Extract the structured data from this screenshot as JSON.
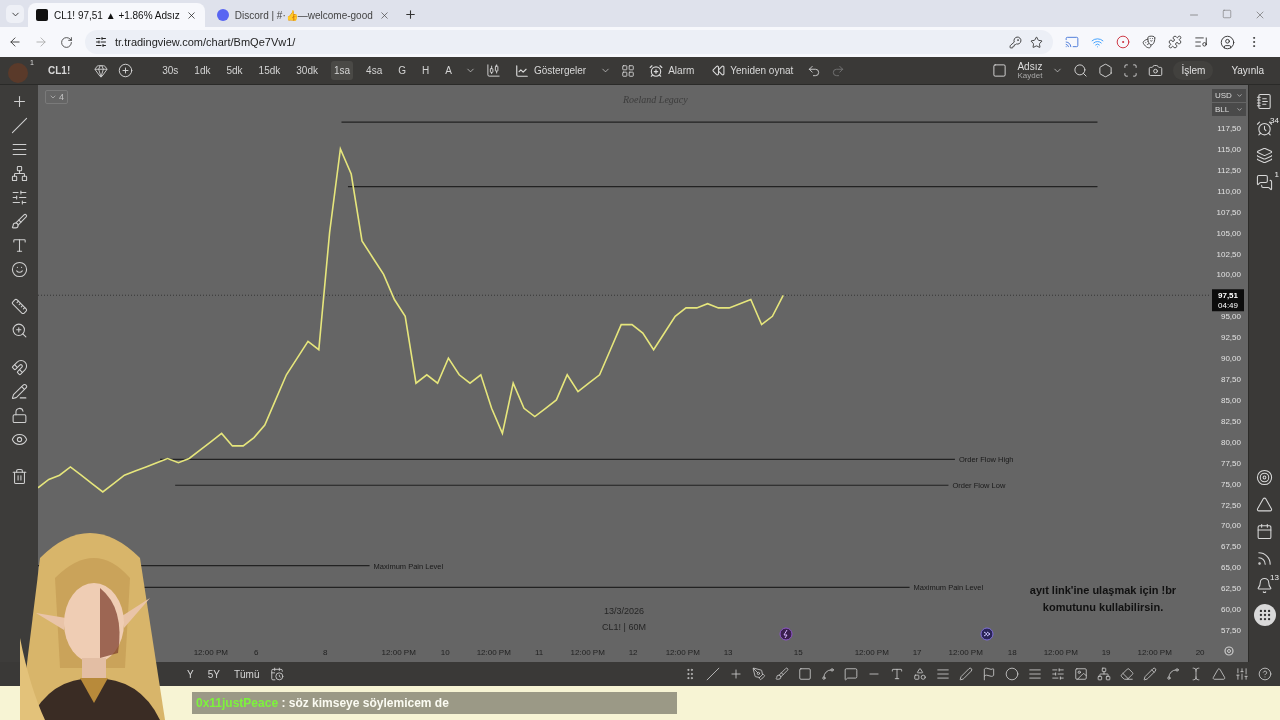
{
  "browser": {
    "tabs": [
      {
        "title": "CL1! 97,51 ▲ +1.86% Adsız",
        "selected": true
      },
      {
        "title": "Discord | #·👍—welcome-good",
        "selected": false
      }
    ],
    "url": "tr.tradingview.com/chart/BmQe7Vw1/"
  },
  "toolbar": {
    "avatar_badge": "1",
    "symbol": "CL1!",
    "intervals": [
      {
        "label": "30s",
        "selected": false
      },
      {
        "label": "1dk",
        "selected": false
      },
      {
        "label": "5dk",
        "selected": false
      },
      {
        "label": "15dk",
        "selected": false
      },
      {
        "label": "30dk",
        "selected": false
      },
      {
        "label": "1sa",
        "selected": true
      },
      {
        "label": "4sa",
        "selected": false
      },
      {
        "label": "G",
        "selected": false
      },
      {
        "label": "H",
        "selected": false
      },
      {
        "label": "A",
        "selected": false
      }
    ],
    "indicators": "Göstergeler",
    "alarm": "Alarm",
    "replay": "Yeniden oynat",
    "layout_name": "Adsız",
    "layout_action": "Kaydet",
    "trade": "İşlem",
    "publish": "Yayınla"
  },
  "chart": {
    "collapse_count": "4",
    "title": "Roeland Legacy",
    "date_watermark": "13/3/2026",
    "symbol_watermark": "CL1! | 60M",
    "currency": "USD",
    "unit": "BLL",
    "price_tag": {
      "price": "97,51",
      "countdown": "04:49"
    },
    "levels": [
      "Order Flow High",
      "Order Flow Low",
      "Maximum Pain Level",
      "Maximum Pain Level"
    ],
    "time_labels": [
      "12:00 PM",
      "6",
      "8",
      "12:00 PM",
      "10",
      "12:00 PM",
      "11",
      "12:00 PM",
      "12",
      "12:00 PM",
      "13",
      "15",
      "12:00 PM",
      "17",
      "12:00 PM",
      "18",
      "12:00 PM",
      "19",
      "12:00 PM",
      "20"
    ],
    "chart_data": {
      "type": "line",
      "ylim": [
        57.5,
        117.5
      ],
      "ref_lines": [
        {
          "axis": "y",
          "value": 97.51
        }
      ],
      "series": [
        {
          "color": "#e6e67c",
          "values": [
            74.5,
            75.5,
            76,
            77,
            76,
            75,
            74,
            75,
            76,
            76.5,
            77,
            77.5,
            78,
            77.5,
            78,
            79,
            80,
            81,
            79.5,
            79.5,
            80.5,
            82,
            85,
            88,
            90,
            92,
            91,
            105,
            115,
            112,
            104,
            102,
            100,
            97,
            95,
            87,
            88,
            87,
            90,
            88,
            87,
            88,
            84,
            81,
            87,
            84,
            83,
            84,
            85,
            88,
            86,
            87,
            88,
            91,
            94,
            94,
            93,
            91,
            93,
            95,
            96,
            96,
            96.5,
            96,
            96,
            96.5,
            97,
            94,
            95,
            97.5
          ]
        }
      ],
      "yticks": [
        {
          "value": 57.5,
          "label": "57,50"
        },
        {
          "value": 60,
          "label": "60,00"
        },
        {
          "value": 62.5,
          "label": "62,50"
        },
        {
          "value": 65,
          "label": "65,00"
        },
        {
          "value": 67.5,
          "label": "67,50"
        },
        {
          "value": 70,
          "label": "70,00"
        },
        {
          "value": 72.5,
          "label": "72,50"
        },
        {
          "value": 75,
          "label": "75,00"
        },
        {
          "value": 77.5,
          "label": "77,50"
        },
        {
          "value": 80,
          "label": "80,00"
        },
        {
          "value": 82.5,
          "label": "82,50"
        },
        {
          "value": 85,
          "label": "85,00"
        },
        {
          "value": 87.5,
          "label": "87,50"
        },
        {
          "value": 90,
          "label": "90,00"
        },
        {
          "value": 92.5,
          "label": "92,50"
        },
        {
          "value": 95,
          "label": "95,00"
        },
        {
          "value": 100,
          "label": "100,00"
        },
        {
          "value": 102.5,
          "label": "102,50"
        },
        {
          "value": 105,
          "label": "105,00"
        },
        {
          "value": 107.5,
          "label": "107,50"
        },
        {
          "value": 110,
          "label": "110,00"
        },
        {
          "value": 112.5,
          "label": "112,50"
        },
        {
          "value": 115,
          "label": "115,00"
        },
        {
          "value": 117.5,
          "label": "117,50"
        }
      ]
    }
  },
  "right_sidebar": {
    "alerts_badge": "34",
    "chat_badge": "1",
    "notifications_badge": "13"
  },
  "bottom_bar": {
    "ranges": [
      "Y",
      "5Y",
      "Tümü"
    ]
  },
  "overlay": {
    "notice": "ayıt link'ine ulaşmak için !br komutunu kullabilirsin.",
    "chat": {
      "user": "0x11justPeace",
      "message": ": söz kimseye söylemicem de"
    }
  }
}
